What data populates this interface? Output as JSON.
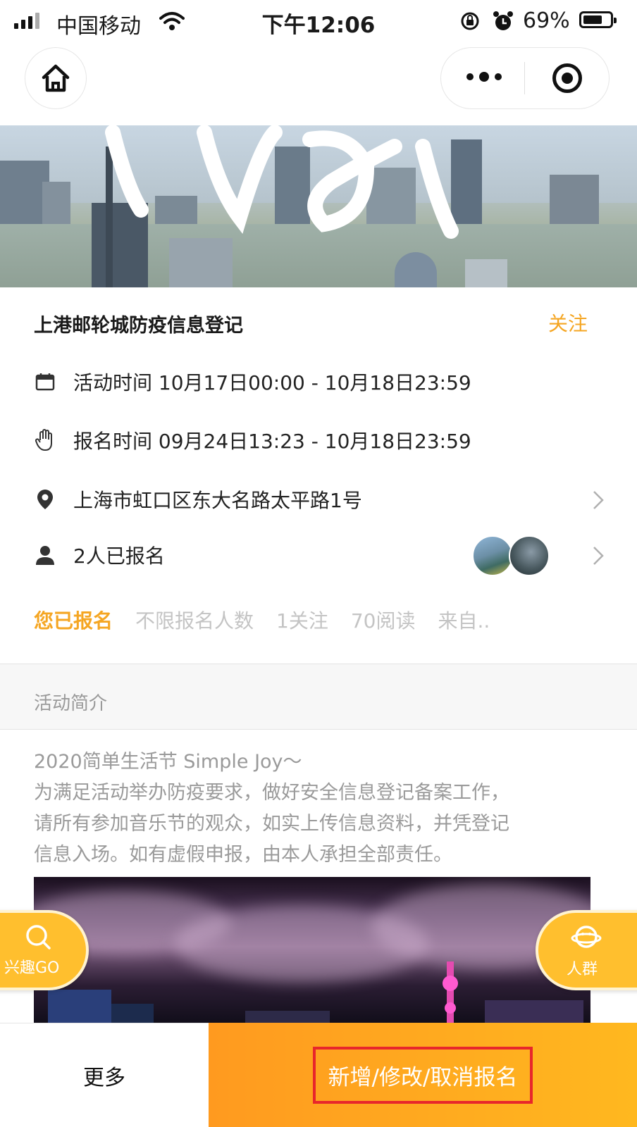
{
  "status_bar": {
    "carrier": "中国移动",
    "time": "下午12:06",
    "battery_pct": "69%"
  },
  "event": {
    "title": "上港邮轮城防疫信息登记",
    "follow_label": "关注",
    "activity_time": "活动时间 10月17日00:00 - 10月18日23:59",
    "signup_time": "报名时间 09月24日13:23 - 10月18日23:59",
    "address": "上海市虹口区东大名路太平路1号",
    "registered_count": "2人已报名"
  },
  "stats": {
    "status": "您已报名",
    "limit": "不限报名人数",
    "follows": "1关注",
    "reads": "70阅读",
    "source": "来自.."
  },
  "intro": {
    "section_title": "活动简介",
    "lines": [
      "2020简单生活节 Simple Joy～",
      "为满足活动举办防疫要求，做好安全信息登记备案工作，",
      "请所有参加音乐节的观众，如实上传信息资料，并凭登记",
      "信息入场。如有虚假申报，由本人承担全部责任。"
    ]
  },
  "floating": {
    "left_label": "兴趣GO",
    "right_label": "人群"
  },
  "bottom_bar": {
    "more_label": "更多",
    "register_label": "新增/修改/取消报名"
  },
  "colors": {
    "accent": "#f5a623",
    "button_gradient_start": "#ff9a1f",
    "button_gradient_end": "#ffb81f",
    "highlight_box": "#e8262b"
  }
}
